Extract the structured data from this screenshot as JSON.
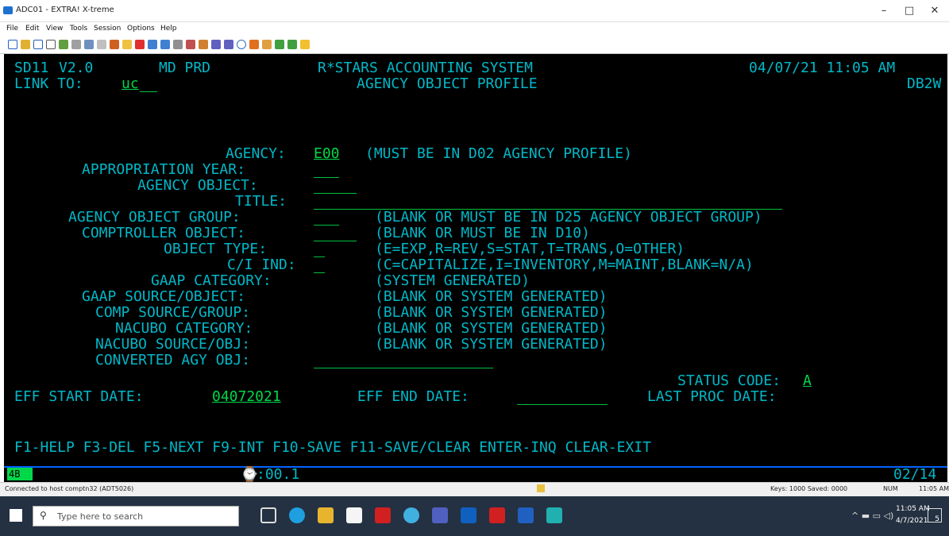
{
  "window": {
    "title": "ADC01 - EXTRA! X-treme",
    "min": "–",
    "max": "□",
    "close": "✕"
  },
  "menu": [
    "File",
    "Edit",
    "View",
    "Tools",
    "Session",
    "Options",
    "Help"
  ],
  "screen": {
    "header": {
      "screen_id": "SD11",
      "version": "V2.0",
      "region": "MD PRD",
      "system": "R*STARS ACCOUNTING SYSTEM",
      "datetime": "04/07/21 11:05 AM",
      "link_label": "LINK TO:",
      "link_value": "uc",
      "subtitle": "AGENCY OBJECT PROFILE",
      "db": "DB2W"
    },
    "fields": {
      "agency_label": "AGENCY:",
      "agency_value": "E00",
      "agency_note": "(MUST BE IN D02 AGENCY PROFILE)",
      "approp_year_label": "APPROPRIATION YEAR:",
      "agency_object_label": "AGENCY OBJECT:",
      "title_label": "TITLE:",
      "object_group_label": "AGENCY OBJECT GROUP:",
      "object_group_note": "(BLANK OR MUST BE IN D25 AGENCY OBJECT GROUP)",
      "comptroller_object_label": "COMPTROLLER OBJECT:",
      "comptroller_object_note": "(BLANK OR MUST BE IN D10)",
      "object_type_label": "OBJECT TYPE:",
      "object_type_note": "(E=EXP,R=REV,S=STAT,T=TRANS,O=OTHER)",
      "ci_ind_label": "C/I IND:",
      "ci_ind_note": "(C=CAPITALIZE,I=INVENTORY,M=MAINT,BLANK=N/A)",
      "gaap_category_label": "GAAP CATEGORY:",
      "gaap_category_note": "(SYSTEM GENERATED)",
      "gaap_source_label": "GAAP SOURCE/OBJECT:",
      "gaap_source_note": "(BLANK OR SYSTEM GENERATED)",
      "comp_source_label": "COMP SOURCE/GROUP:",
      "comp_source_note": "(BLANK OR SYSTEM GENERATED)",
      "nacubo_category_label": "NACUBO CATEGORY:",
      "nacubo_category_note": "(BLANK OR SYSTEM GENERATED)",
      "nacubo_source_label": "NACUBO SOURCE/OBJ:",
      "nacubo_source_note": "(BLANK OR SYSTEM GENERATED)",
      "converted_label": "CONVERTED AGY OBJ:",
      "status_label": "STATUS CODE:",
      "status_value": "A",
      "eff_start_label": "EFF START DATE:",
      "eff_start_value": "04072021",
      "eff_end_label": "EFF END DATE:",
      "last_proc_label": "LAST PROC DATE:"
    },
    "pfkeys": "F1-HELP F3-DEL F5-NEXT F9-INT F10-SAVE F11-SAVE/CLEAR ENTER-INQ CLEAR-EXIT",
    "oia": {
      "session": "4B",
      "timer": ":00.1",
      "cursor": "02/14"
    }
  },
  "statusbar": {
    "connection": "Connected to host comptn32 (ADT5026)",
    "keys": "Keys: 1000 Saved: 0000",
    "num": "NUM",
    "time": "11:05 AM"
  },
  "taskbar": {
    "search_placeholder": "Type here to search",
    "time": "11:05 AM",
    "date": "4/7/2021",
    "badge": "5"
  },
  "colors": {
    "screen_bg": "#000000",
    "label": "#00b8c8",
    "field": "#00d84a",
    "oia_border": "#0064ff",
    "taskbar": "#243142"
  }
}
